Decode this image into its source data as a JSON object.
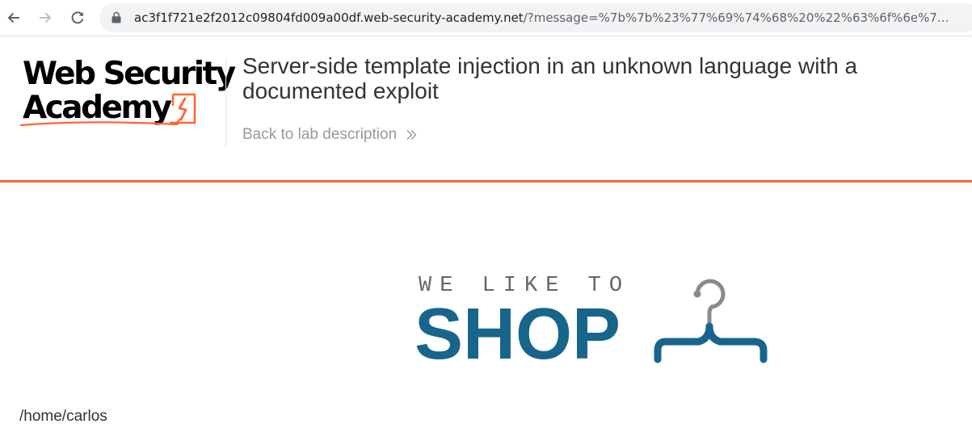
{
  "browser": {
    "back_icon": "arrow-left-icon",
    "forward_icon": "arrow-right-icon",
    "reload_icon": "reload-icon",
    "lock_icon": "lock-icon",
    "url_host": "ac3f1f721e2f2012c09804fd009a00df.web-security-academy.net",
    "url_rest": "/?message=%7b%7b%23%77%69%74%68%20%22%63%6f%6e%7..."
  },
  "header": {
    "logo_line1": "Web Security",
    "logo_line2": "Academy",
    "lab_title": "Server-side template injection in an unknown language with a documented exploit",
    "back_link": "Back to lab description",
    "accent_color": "#ff6633"
  },
  "shop": {
    "tagline": "WE LIKE TO",
    "word": "SHOP",
    "brand_color": "#18658c"
  },
  "output": {
    "text": "/home/carlos"
  }
}
